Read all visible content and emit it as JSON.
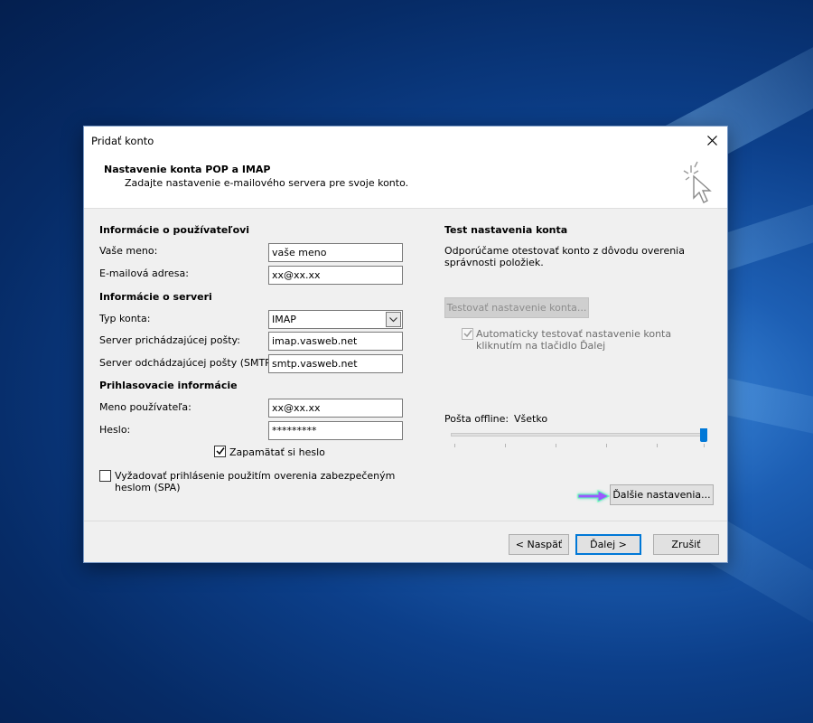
{
  "window": {
    "title": "Pridať konto",
    "close_icon": "close-icon"
  },
  "header": {
    "title": "Nastavenie konta POP a IMAP",
    "subtitle": "Zadajte nastavenie e-mailového servera pre svoje konto."
  },
  "user_info": {
    "section_title": "Informácie o používateľovi",
    "name_label": "Vaše meno:",
    "name_value": "vaše meno",
    "email_label": "E-mailová adresa:",
    "email_value": "xx@xx.xx"
  },
  "server_info": {
    "section_title": "Informácie o serveri",
    "account_type_label": "Typ konta:",
    "account_type_value": "IMAP",
    "incoming_label": "Server prichádzajúcej pošty:",
    "incoming_value": "imap.vasweb.net",
    "outgoing_label": "Server odchádzajúcej pošty (SMTP):",
    "outgoing_value": "smtp.vasweb.net"
  },
  "login_info": {
    "section_title": "Prihlasovacie informácie",
    "username_label": "Meno používateľa:",
    "username_value": "xx@xx.xx",
    "password_label": "Heslo:",
    "password_value": "*********",
    "remember_label": "Zapamätať si heslo",
    "remember_checked": true,
    "spa_label_line1": "Vyžadovať prihlásenie použitím overenia zabezpečeným",
    "spa_label_line2": "heslom (SPA)",
    "spa_checked": false
  },
  "test_settings": {
    "section_title": "Test nastavenia konta",
    "description_line1": "Odporúčame otestovať konto z dôvodu overenia",
    "description_line2": "správnosti položiek.",
    "test_button": "Testovať nastavenie konta...",
    "auto_test_line1": "Automaticky testovať nastavenie konta",
    "auto_test_line2": "kliknutím na tlačidlo Ďalej",
    "auto_test_checked": true
  },
  "offline": {
    "label": "Pošta offline:",
    "value": "Všetko",
    "slider_level": 1.0
  },
  "more_settings_button": "Ďalšie nastavenia...",
  "footer": {
    "back_button": "< Naspäť",
    "next_button": "Ďalej >",
    "cancel_button": "Zrušiť"
  },
  "colors": {
    "accent": "#0078d7",
    "arrow_annotation": "#9b59ff"
  }
}
